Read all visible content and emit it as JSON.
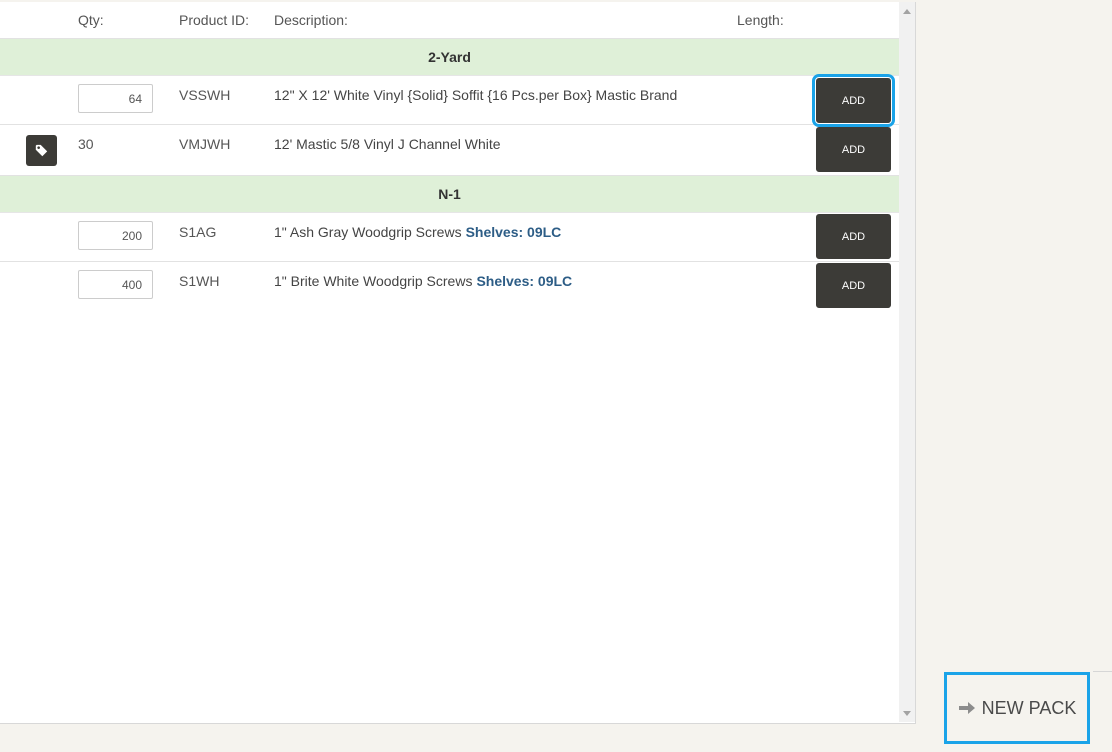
{
  "table": {
    "headers": {
      "qty": "Qty:",
      "product_id": "Product ID:",
      "description": "Description:",
      "length": "Length:"
    },
    "groups": [
      {
        "name": "2-Yard",
        "items": [
          {
            "qty": "64",
            "qty_editable": true,
            "product_id": "VSSWH",
            "description": "12\" X 12' White Vinyl {Solid} Soffit {16 Pcs.per Box} Mastic Brand",
            "shelves": "",
            "button": "ADD"
          },
          {
            "qty": "30",
            "qty_editable": false,
            "tag_icon": "tag-icon",
            "product_id": "VMJWH",
            "description": "12' Mastic 5/8 Vinyl J Channel White",
            "shelves": "",
            "button": "ADD"
          }
        ]
      },
      {
        "name": "N-1",
        "items": [
          {
            "qty": "200",
            "qty_editable": true,
            "product_id": "S1AG",
            "description": "1\" Ash Gray Woodgrip Screws",
            "shelves": "Shelves: 09LC",
            "button": "ADD"
          },
          {
            "qty": "400",
            "qty_editable": true,
            "product_id": "S1WH",
            "description": "1\" Brite White Woodgrip Screws",
            "shelves": "Shelves: 09LC",
            "button": "ADD"
          }
        ]
      }
    ]
  },
  "new_pack": {
    "label": "NEW PACK",
    "icon": "arrow-right-icon"
  },
  "colors": {
    "group_background": "#dff0d8",
    "button_background": "#3c3b37",
    "focus_outline": "#1aa3e8",
    "shelves_text": "#2d5d86",
    "page_background": "#f5f3ee"
  }
}
